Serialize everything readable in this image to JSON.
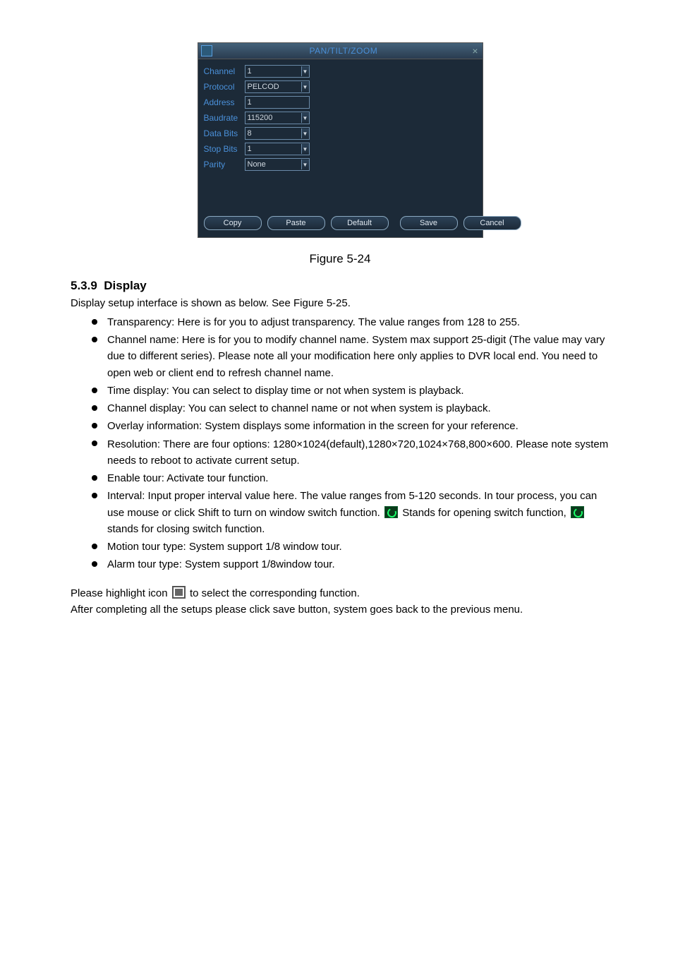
{
  "dialog": {
    "title": "PAN/TILT/ZOOM",
    "rows": {
      "channel": {
        "label": "Channel",
        "value": "1",
        "dropdown": true
      },
      "protocol": {
        "label": "Protocol",
        "value": "PELCOD",
        "dropdown": true
      },
      "address": {
        "label": "Address",
        "value": "1",
        "dropdown": false
      },
      "baudrate": {
        "label": "Baudrate",
        "value": "115200",
        "dropdown": true
      },
      "databits": {
        "label": "Data Bits",
        "value": "8",
        "dropdown": true
      },
      "stopbits": {
        "label": "Stop Bits",
        "value": "1",
        "dropdown": true
      },
      "parity": {
        "label": "Parity",
        "value": "None",
        "dropdown": true
      }
    },
    "buttons": {
      "copy": "Copy",
      "paste": "Paste",
      "default": "Default",
      "save": "Save",
      "cancel": "Cancel"
    }
  },
  "caption": "Figure 5-24",
  "section": {
    "number": "5.3.9",
    "title": "Display"
  },
  "intro": "Display setup interface is shown as below. See Figure 5-25.",
  "bullets": {
    "b1": "Transparency: Here is for you to adjust transparency. The value ranges from 128 to 255.",
    "b2": "Channel name: Here is for you to modify channel name. System max support 25-digit (The value may vary due to different series). Please note all your modification here only applies to DVR local end. You need to open web or client end to refresh channel name.",
    "b3": "Time display: You can select to display time or not when system is playback.",
    "b4": "Channel display: You can select to channel name or not when system is playback.",
    "b5": "Overlay information: System displays some information in the screen for your reference.",
    "b6": "Resolution: There are four options: 1280×1024(default),1280×720,1024×768,800×600. Please note system needs to reboot to activate current setup.",
    "b7": "Enable tour: Activate tour function.",
    "b8a": "Interval: Input proper interval value here. The value ranges from 5-120 seconds. In tour process, you can use mouse or click Shift to turn on window switch function. ",
    "b8b": " Stands for opening switch function, ",
    "b8c": " stands for closing switch function.",
    "b9": "Motion tour type: System support 1/8 window tour.",
    "b10": "Alarm tour type: System support 1/8window tour."
  },
  "tail": {
    "t1a": "Please highlight icon ",
    "t1b": " to select the corresponding function.",
    "t2": "After completing all the setups please click save button, system goes back to the previous menu."
  }
}
